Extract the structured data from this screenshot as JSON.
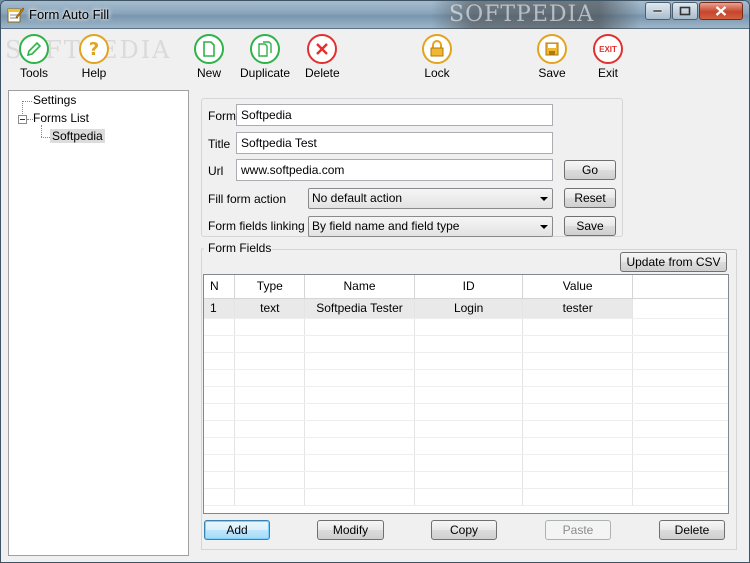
{
  "window": {
    "title": "Form Auto Fill",
    "watermark": "SOFTPEDIA"
  },
  "toolbar": {
    "watermark": "SOFTPEDIA",
    "items": [
      {
        "label": "Tools",
        "icon": "pencil-icon",
        "color": "#2fb24a"
      },
      {
        "label": "Help",
        "icon": "question-icon",
        "color": "#e2a31f"
      },
      {
        "label": "New",
        "icon": "new-document-icon",
        "color": "#2fb24a"
      },
      {
        "label": "Duplicate",
        "icon": "duplicate-document-icon",
        "color": "#2fb24a"
      },
      {
        "label": "Delete",
        "icon": "delete-x-icon",
        "color": "#e23030"
      },
      {
        "label": "Lock",
        "icon": "lock-icon",
        "color": "#e2a31f"
      },
      {
        "label": "Save",
        "icon": "floppy-disk-icon",
        "color": "#e2a31f"
      },
      {
        "label": "Exit",
        "icon": "exit-icon",
        "color": "#e23030"
      }
    ]
  },
  "tree": {
    "settings": "Settings",
    "forms_list": "Forms List",
    "forms": [
      "Softpedia"
    ]
  },
  "form": {
    "form_label": "Form",
    "form_value": "Softpedia",
    "title_label": "Title",
    "title_value": "Softpedia Test",
    "url_label": "Url",
    "url_value": "www.softpedia.com",
    "go_button": "Go",
    "fill_action_label": "Fill form action",
    "fill_action_value": "No default action",
    "reset_button": "Reset",
    "linking_label": "Form fields linking",
    "linking_value": "By field name and field type",
    "save_button": "Save"
  },
  "form_fields": {
    "group_title": "Form Fields",
    "update_csv_button": "Update from CSV",
    "columns": [
      "N",
      "Type",
      "Name",
      "ID",
      "Value"
    ],
    "rows": [
      [
        "1",
        "text",
        "Softpedia Tester",
        "Login",
        "tester"
      ]
    ],
    "buttons": {
      "add": "Add",
      "modify": "Modify",
      "copy": "Copy",
      "paste": "Paste",
      "delete": "Delete"
    }
  }
}
